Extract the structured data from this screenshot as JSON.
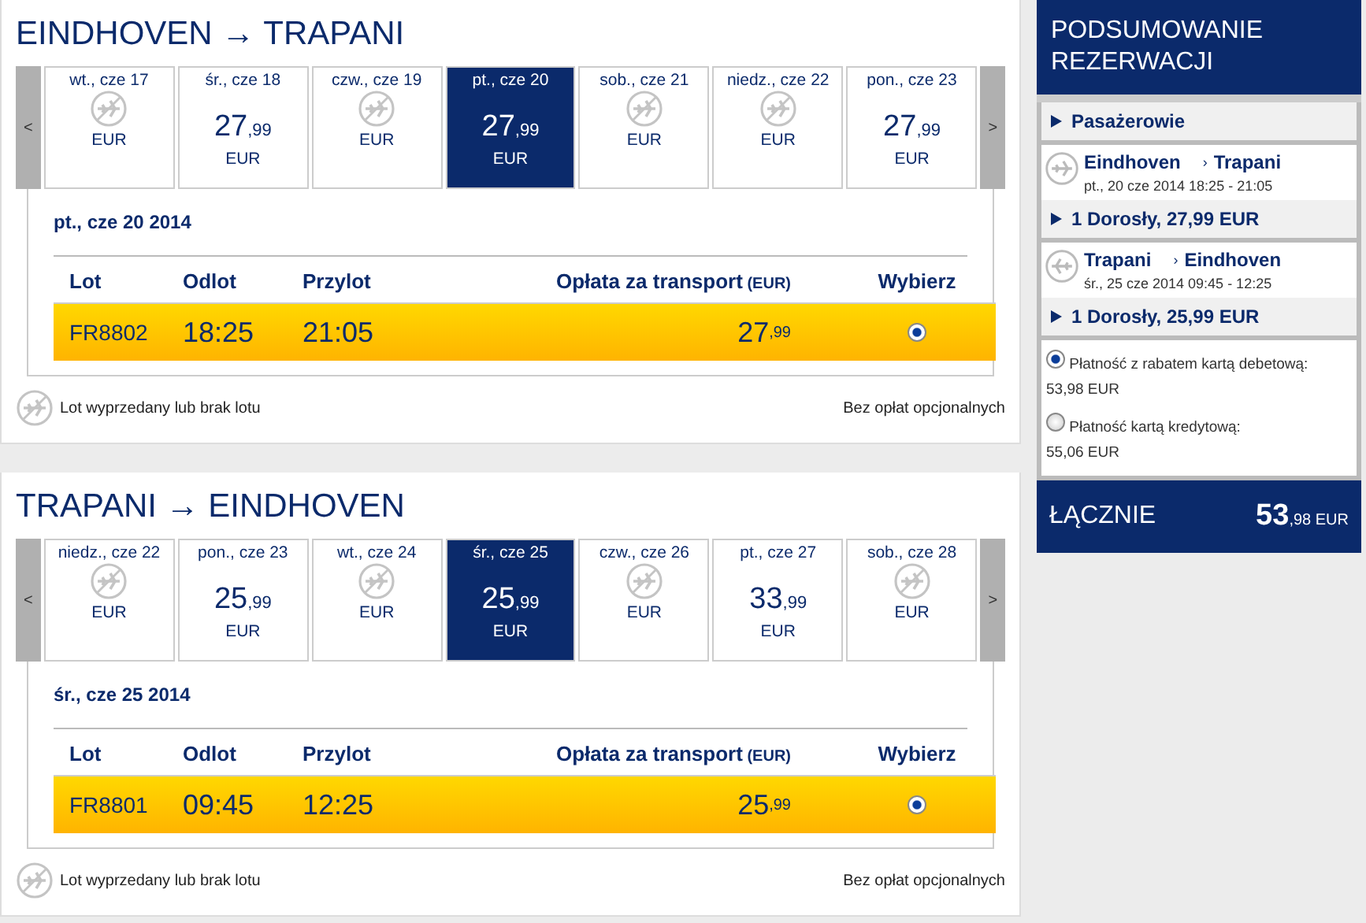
{
  "journeys": [
    {
      "title": "EINDHOVEN → TRAPANI",
      "prev": "<",
      "next": ">",
      "days": [
        {
          "label": "wt., cze 17",
          "kind": "soldout",
          "currency": "EUR",
          "selected": false
        },
        {
          "label": "śr., cze 18",
          "kind": "fare",
          "price": "27",
          "cents": ",99",
          "currency": "EUR",
          "selected": false
        },
        {
          "label": "czw., cze 19",
          "kind": "soldout",
          "currency": "EUR",
          "selected": false
        },
        {
          "label": "pt., cze 20",
          "kind": "fare",
          "price": "27",
          "cents": ",99",
          "currency": "EUR",
          "selected": true
        },
        {
          "label": "sob., cze 21",
          "kind": "soldout",
          "currency": "EUR",
          "selected": false
        },
        {
          "label": "niedz., cze 22",
          "kind": "soldout",
          "currency": "EUR",
          "selected": false
        },
        {
          "label": "pon., cze 23",
          "kind": "fare",
          "price": "27",
          "cents": ",99",
          "currency": "EUR",
          "selected": false
        }
      ],
      "date": "pt., cze 20 2014",
      "columns": [
        {
          "label": "Lot"
        },
        {
          "label": "Odlot"
        },
        {
          "label": "Przylot"
        },
        {
          "label": "Opłata za transport",
          "unit": "(EUR)"
        },
        {
          "label": "Wybierz"
        }
      ],
      "rows": [
        {
          "flight": "FR8802",
          "departure": "18:25",
          "arrival": "21:05",
          "price": "27",
          "cents": ",99",
          "selected": true
        }
      ],
      "legend": "Lot wyprzedany lub brak lotu",
      "note": "Bez opłat opcjonalnych"
    },
    {
      "title": "TRAPANI → EINDHOVEN",
      "prev": "<",
      "next": ">",
      "days": [
        {
          "label": "niedz., cze 22",
          "kind": "soldout",
          "currency": "EUR",
          "selected": false
        },
        {
          "label": "pon., cze 23",
          "kind": "fare",
          "price": "25",
          "cents": ",99",
          "currency": "EUR",
          "selected": false
        },
        {
          "label": "wt., cze 24",
          "kind": "soldout",
          "currency": "EUR",
          "selected": false
        },
        {
          "label": "śr., cze 25",
          "kind": "fare",
          "price": "25",
          "cents": ",99",
          "currency": "EUR",
          "selected": true
        },
        {
          "label": "czw., cze 26",
          "kind": "soldout",
          "currency": "EUR",
          "selected": false
        },
        {
          "label": "pt., cze 27",
          "kind": "fare",
          "price": "33",
          "cents": ",99",
          "currency": "EUR",
          "selected": false
        },
        {
          "label": "sob., cze 28",
          "kind": "soldout",
          "currency": "EUR",
          "selected": false
        }
      ],
      "date": "śr., cze 25 2014",
      "columns": [
        {
          "label": "Lot"
        },
        {
          "label": "Odlot"
        },
        {
          "label": "Przylot"
        },
        {
          "label": "Opłata za transport",
          "unit": "(EUR)"
        },
        {
          "label": "Wybierz"
        }
      ],
      "rows": [
        {
          "flight": "FR8801",
          "departure": "09:45",
          "arrival": "12:25",
          "price": "25",
          "cents": ",99",
          "selected": true
        }
      ],
      "legend": "Lot wyprzedany lub brak lotu",
      "note": "Bez opłat opcjonalnych"
    }
  ],
  "summary": {
    "title": "PODSUMOWANIE REZERWACJI",
    "passengers": "Pasażerowie",
    "legs": [
      {
        "kind": "outbound",
        "from": "Eindhoven",
        "separator": "›",
        "to": "Trapani",
        "when": "pt., 20 cze 2014 18:25 - 21:05",
        "fare": "1 Dorosły, 27,99 EUR"
      },
      {
        "kind": "return",
        "from": "Trapani",
        "separator": "›",
        "to": "Eindhoven",
        "when": "śr., 25 cze 2014 09:45 - 12:25",
        "fare": "1 Dorosły, 25,99 EUR"
      }
    ],
    "payments": [
      {
        "label": "Płatność z rabatem kartą debetową:",
        "amount": "53,98 EUR",
        "selected": true
      },
      {
        "label": "Płatność kartą kredytową:",
        "amount": "55,06 EUR",
        "selected": false
      }
    ],
    "total": {
      "label": "ŁĄCZNIE",
      "price": "53",
      "cents": ",98",
      "currency": "EUR"
    }
  }
}
